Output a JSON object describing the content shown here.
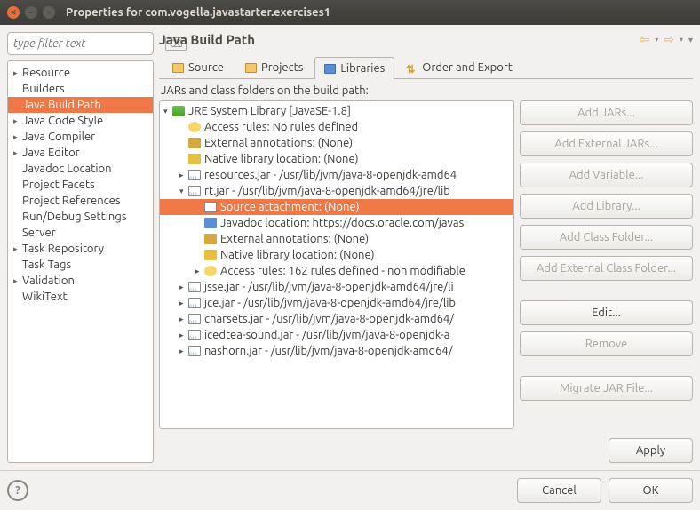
{
  "window": {
    "title": "Properties for com.vogella.javastarter.exercises1"
  },
  "filter": {
    "placeholder": "type filter text"
  },
  "nav": {
    "items": [
      {
        "label": "Resource",
        "arrow": "▸"
      },
      {
        "label": "Builders",
        "arrow": ""
      },
      {
        "label": "Java Build Path",
        "arrow": "",
        "selected": true
      },
      {
        "label": "Java Code Style",
        "arrow": "▸"
      },
      {
        "label": "Java Compiler",
        "arrow": "▸"
      },
      {
        "label": "Java Editor",
        "arrow": "▸"
      },
      {
        "label": "Javadoc Location",
        "arrow": ""
      },
      {
        "label": "Project Facets",
        "arrow": ""
      },
      {
        "label": "Project References",
        "arrow": ""
      },
      {
        "label": "Run/Debug Settings",
        "arrow": ""
      },
      {
        "label": "Server",
        "arrow": ""
      },
      {
        "label": "Task Repository",
        "arrow": "▸"
      },
      {
        "label": "Task Tags",
        "arrow": ""
      },
      {
        "label": "Validation",
        "arrow": "▸"
      },
      {
        "label": "WikiText",
        "arrow": ""
      }
    ]
  },
  "page": {
    "title": "Java Build Path"
  },
  "tabs": {
    "source": "Source",
    "projects": "Projects",
    "libraries": "Libraries",
    "order": "Order and Export"
  },
  "desc": "JARs and class folders on the build path:",
  "tree": {
    "root": "JRE System Library [JavaSE-1.8]",
    "nodes": [
      {
        "d": 1,
        "a": "",
        "i": "rule",
        "t": "Access rules: No rules defined"
      },
      {
        "d": 1,
        "a": "",
        "i": "annot",
        "t": "External annotations: (None)"
      },
      {
        "d": 1,
        "a": "",
        "i": "native",
        "t": "Native library location: (None)"
      },
      {
        "d": 1,
        "a": "▸",
        "i": "jar",
        "t": "resources.jar - /usr/lib/jvm/java-8-openjdk-amd64"
      },
      {
        "d": 1,
        "a": "▾",
        "i": "jar",
        "t": "rt.jar - /usr/lib/jvm/java-8-openjdk-amd64/jre/lib"
      },
      {
        "d": 2,
        "a": "",
        "i": "src",
        "t": "Source attachment: (None)",
        "sel": true
      },
      {
        "d": 2,
        "a": "",
        "i": "doc",
        "t": "Javadoc location: https://docs.oracle.com/javas"
      },
      {
        "d": 2,
        "a": "",
        "i": "annot",
        "t": "External annotations: (None)"
      },
      {
        "d": 2,
        "a": "",
        "i": "native",
        "t": "Native library location: (None)"
      },
      {
        "d": 2,
        "a": "▸",
        "i": "rule",
        "t": "Access rules: 162 rules defined - non modifiable"
      },
      {
        "d": 1,
        "a": "▸",
        "i": "jar",
        "t": "jsse.jar - /usr/lib/jvm/java-8-openjdk-amd64/jre/li"
      },
      {
        "d": 1,
        "a": "▸",
        "i": "jar",
        "t": "jce.jar - /usr/lib/jvm/java-8-openjdk-amd64/jre/lib"
      },
      {
        "d": 1,
        "a": "▸",
        "i": "jar",
        "t": "charsets.jar - /usr/lib/jvm/java-8-openjdk-amd64/"
      },
      {
        "d": 1,
        "a": "▸",
        "i": "jar",
        "t": "icedtea-sound.jar - /usr/lib/jvm/java-8-openjdk-a"
      },
      {
        "d": 1,
        "a": "▸",
        "i": "jar",
        "t": "nashorn.jar - /usr/lib/jvm/java-8-openjdk-amd64/"
      }
    ]
  },
  "buttons": {
    "addJars": "Add JARs...",
    "addExtJars": "Add External JARs...",
    "addVar": "Add Variable...",
    "addLib": "Add Library...",
    "addCF": "Add Class Folder...",
    "addExtCF": "Add External Class Folder...",
    "edit": "Edit...",
    "remove": "Remove",
    "migrate": "Migrate JAR File...",
    "apply": "Apply",
    "cancel": "Cancel",
    "ok": "OK"
  }
}
